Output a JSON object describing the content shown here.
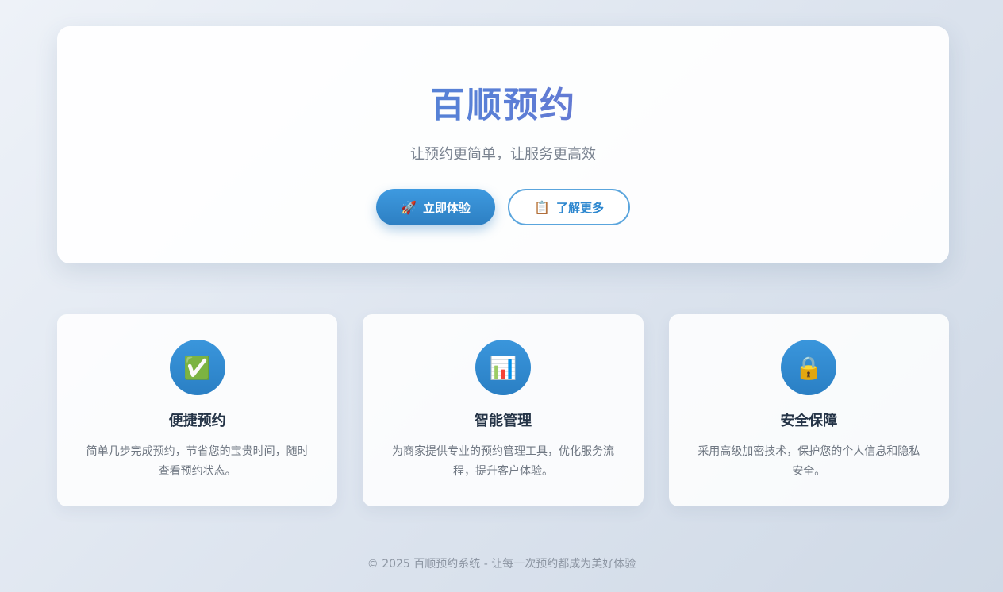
{
  "hero": {
    "title": "百顺预约",
    "subtitle": "让预约更简单，让服务更高效",
    "primary_button": {
      "icon": "rocket-icon",
      "icon_glyph": "🚀",
      "label": "立即体验"
    },
    "secondary_button": {
      "icon": "clipboard-icon",
      "icon_glyph": "📋",
      "label": "了解更多"
    }
  },
  "features": [
    {
      "icon": "check-icon",
      "icon_glyph": "✅",
      "title": "便捷预约",
      "desc": "简单几步完成预约，节省您的宝贵时间，随时查看预约状态。"
    },
    {
      "icon": "chart-icon",
      "icon_glyph": "📊",
      "title": "智能管理",
      "desc": "为商家提供专业的预约管理工具，优化服务流程，提升客户体验。"
    },
    {
      "icon": "lock-icon",
      "icon_glyph": "🔒",
      "title": "安全保障",
      "desc": "采用高级加密技术，保护您的个人信息和隐私安全。"
    }
  ],
  "footer": {
    "text": "© 2025 百顺预约系统 - 让每一次预约都成为美好体验"
  },
  "colors": {
    "accent": "#2d87cf",
    "title_gradient_start": "#3a8fd8",
    "title_gradient_end": "#8e5fc4"
  }
}
